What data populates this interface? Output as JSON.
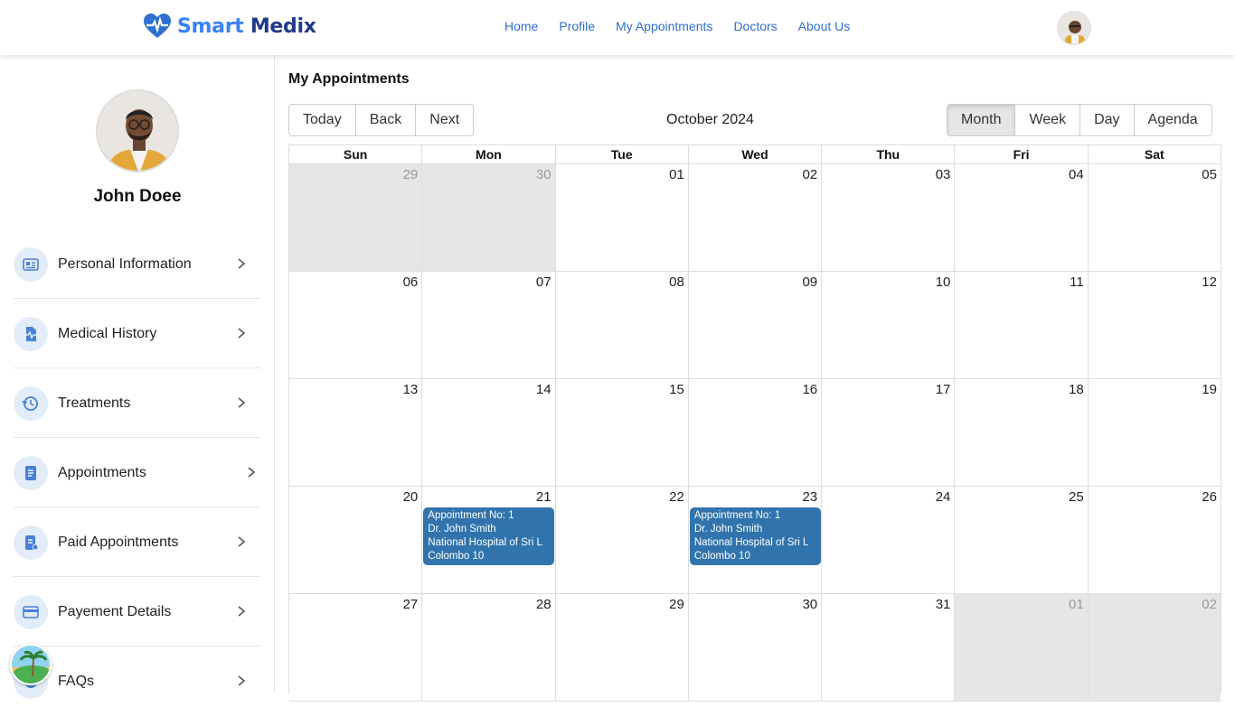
{
  "brand": {
    "name_part1": "Smart",
    "name_part2": "Medix",
    "logo_icon": "heart-pulse-icon",
    "colors": {
      "primary": "#3b82f6",
      "dark": "#1e3a8a"
    }
  },
  "nav": [
    "Home",
    "Profile",
    "My Appointments",
    "Doctors",
    "About Us"
  ],
  "user": {
    "name": "John Doee"
  },
  "sidebar": {
    "items": [
      {
        "label": "Personal Information",
        "icon": "id-card-icon"
      },
      {
        "label": "Medical History",
        "icon": "medical-file-icon"
      },
      {
        "label": "Treatments",
        "icon": "history-icon"
      },
      {
        "label": "Appointments",
        "icon": "document-icon"
      },
      {
        "label": "Paid Appointments",
        "icon": "receipt-icon"
      },
      {
        "label": "Payement Details",
        "icon": "credit-card-icon"
      },
      {
        "label": "FAQs",
        "icon": "question-icon"
      }
    ]
  },
  "main": {
    "title": "My Appointments",
    "toolbar": {
      "today": "Today",
      "back": "Back",
      "next": "Next",
      "label": "October 2024"
    },
    "views": {
      "month": "Month",
      "week": "Week",
      "day": "Day",
      "agenda": "Agenda",
      "active": "Month"
    }
  },
  "calendar": {
    "weekdays": [
      "Sun",
      "Mon",
      "Tue",
      "Wed",
      "Thu",
      "Fri",
      "Sat"
    ],
    "weeks": [
      [
        {
          "d": "29",
          "off": true
        },
        {
          "d": "30",
          "off": true
        },
        {
          "d": "01"
        },
        {
          "d": "02"
        },
        {
          "d": "03"
        },
        {
          "d": "04"
        },
        {
          "d": "05"
        }
      ],
      [
        {
          "d": "06"
        },
        {
          "d": "07"
        },
        {
          "d": "08"
        },
        {
          "d": "09"
        },
        {
          "d": "10"
        },
        {
          "d": "11"
        },
        {
          "d": "12"
        }
      ],
      [
        {
          "d": "13"
        },
        {
          "d": "14"
        },
        {
          "d": "15"
        },
        {
          "d": "16"
        },
        {
          "d": "17"
        },
        {
          "d": "18"
        },
        {
          "d": "19"
        }
      ],
      [
        {
          "d": "20"
        },
        {
          "d": "21"
        },
        {
          "d": "22"
        },
        {
          "d": "23"
        },
        {
          "d": "24"
        },
        {
          "d": "25"
        },
        {
          "d": "26"
        }
      ],
      [
        {
          "d": "27"
        },
        {
          "d": "28"
        },
        {
          "d": "29"
        },
        {
          "d": "30"
        },
        {
          "d": "31"
        },
        {
          "d": "01",
          "off": true
        },
        {
          "d": "02",
          "off": true
        }
      ]
    ],
    "events": [
      {
        "week": 3,
        "day": 1,
        "lines": [
          "Appointment No: 1",
          "Dr. John Smith",
          "National Hospital of Sri L",
          "Colombo 10"
        ]
      },
      {
        "week": 3,
        "day": 3,
        "lines": [
          "Appointment No: 1",
          "Dr. John Smith",
          "National Hospital of Sri L",
          "Colombo 10"
        ]
      }
    ],
    "event_color": "#3174ad",
    "off_color": "#e6e6e6"
  }
}
